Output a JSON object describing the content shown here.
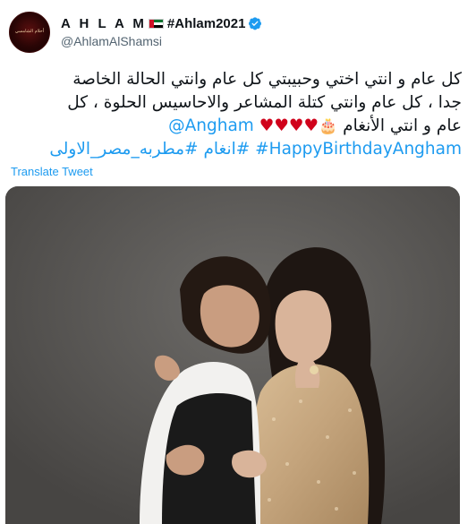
{
  "tweet": {
    "author": {
      "display_name": "A H L A M",
      "flag": "uae-flag",
      "name_hashtag": "#Ahlam2021",
      "verified_icon": "verified-badge-icon",
      "handle": "@AhlamAlShamsi",
      "avatar_text": "أحلام الشامسي"
    },
    "text": {
      "line1": "كل عام و انتي اختي وحبيبتي كل عام وانتي الحالة الخاصة",
      "line2": "جدا ، كل عام وانتي كتلة المشاعر والاحاسيس الحلوة ، كل",
      "line3_text": "عام و انتي الأنغام",
      "line3_cake": "🎂",
      "line3_hearts": "♥♥♥♥",
      "line3_mention": "@Angham"
    },
    "hashtags": [
      "#HappyBirthdayAngham",
      "#انغام",
      "#مطربه_مصر_الاولى"
    ],
    "translate_label": "Translate Tweet",
    "colors": {
      "link": "#1d9bf0",
      "text": "#0f1419",
      "secondary": "#536471",
      "heart": "#d0021b"
    }
  }
}
